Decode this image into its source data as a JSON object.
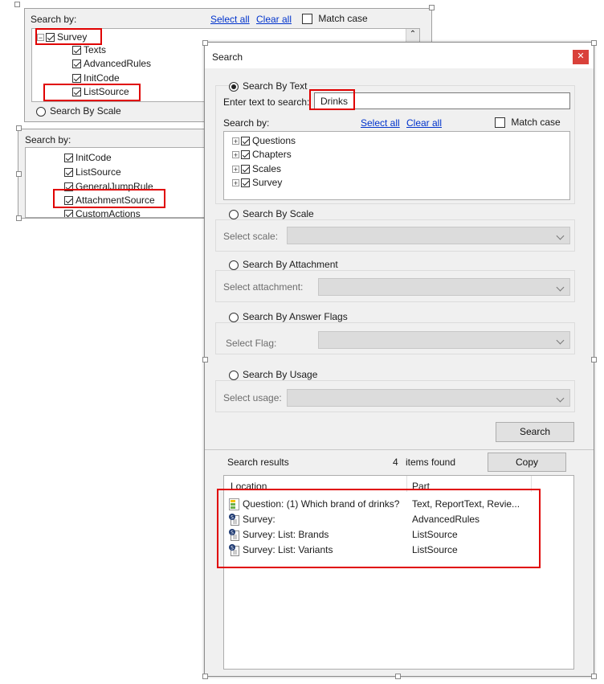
{
  "background_panel": {
    "search_by_label": "Search by:",
    "select_all": "Select all",
    "clear_all": "Clear all",
    "match_case": "Match case",
    "tree": [
      {
        "label": "Survey",
        "checked": true
      },
      {
        "label": "Texts",
        "checked": true
      },
      {
        "label": "AdvancedRules",
        "checked": true
      },
      {
        "label": "InitCode",
        "checked": true
      },
      {
        "label": "ListSource",
        "checked": true
      }
    ],
    "search_by_scale": "Search By Scale"
  },
  "background_panel2": {
    "search_by_label": "Search by:",
    "tree": [
      {
        "label": "InitCode",
        "checked": true
      },
      {
        "label": "ListSource",
        "checked": true
      },
      {
        "label": "GeneralJumpRule",
        "checked": true
      },
      {
        "label": "AttachmentSource",
        "checked": true
      },
      {
        "label": "CustomActions",
        "checked": true
      }
    ]
  },
  "dialog": {
    "title": "Search",
    "close_icon": "close-icon",
    "search_by_text": "Search By Text",
    "enter_text_label": "Enter text to search:",
    "search_value": "Drinks",
    "search_by_label": "Search by:",
    "select_all": "Select all",
    "clear_all": "Clear all",
    "match_case": "Match case",
    "tree": [
      {
        "label": "Questions",
        "checked": true
      },
      {
        "label": "Chapters",
        "checked": true
      },
      {
        "label": "Scales",
        "checked": true
      },
      {
        "label": "Survey",
        "checked": true
      }
    ],
    "search_by_scale": "Search By Scale",
    "select_scale": "Select scale:",
    "search_by_attachment": "Search By Attachment",
    "select_attachment": "Select attachment:",
    "search_by_answer_flags": "Search By Answer Flags",
    "select_flag": "Select Flag:",
    "search_by_usage": "Search By Usage",
    "select_usage": "Select usage:",
    "search_button": "Search",
    "search_results_label": "Search results",
    "items_count": "4",
    "items_found": "items found",
    "copy_button": "Copy",
    "columns": [
      "Location",
      "Part"
    ],
    "results": [
      {
        "icon": "question-icon",
        "location": "Question: (1) Which brand of drinks?",
        "part": "Text, ReportText, Revie..."
      },
      {
        "icon": "script-icon",
        "location": "Survey:",
        "part": "AdvancedRules"
      },
      {
        "icon": "script-icon",
        "location": "Survey: List: Brands",
        "part": "ListSource"
      },
      {
        "icon": "script-icon",
        "location": "Survey: List: Variants",
        "part": "ListSource"
      }
    ]
  }
}
